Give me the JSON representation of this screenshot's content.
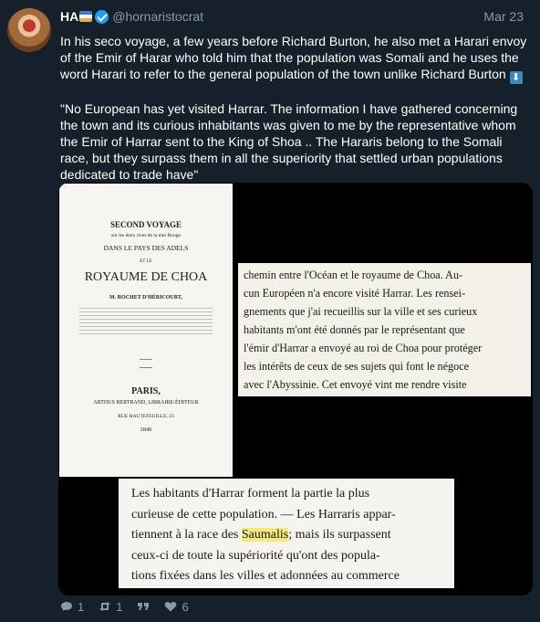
{
  "tweet": {
    "name": "HA",
    "handle": "@hornaristocrat",
    "date": "Mar 23",
    "paragraph1": "In his seco voyage, a few years before Richard Burton, he also met a Harari envoy of the Emir of Harar who told him that the population was Somali and he uses the word Harari to refer to the general population of the town unlike Richard Burton",
    "paragraph2": "\"No European has yet visited Harrar. The information I have gathered concerning the town and its curious inhabitants was given to me by the representative whom the Emir of Harrar sent to the King of Shoa .. The Hararis belong to the Somali race, but they surpass them in all the superiority that settled urban populations dedicated to trade have\""
  },
  "book_cover": {
    "title1": "SECOND VOYAGE",
    "title2": "sur les deux rives de la mer Rouge",
    "title3": "DANS LE PAYS DES ADELS",
    "title4": "ET LE",
    "title5": "ROYAUME DE CHOA",
    "author": "M. ROCHET D'HÉRICOURT,",
    "city": "PARIS,",
    "publisher": "ARTHUS BERTRAND, LIBRAIRE-ÉDITEUR",
    "address": "RUE HAUTEFEUILLE, 23",
    "year": "1846"
  },
  "scan1": {
    "lines": [
      "chemin entre l'Océan et le royaume de Choa. Au-",
      "cun Européen n'a encore visité Harrar. Les rensei-",
      "gnements que j'ai recueillis sur la ville et ses curieux",
      "habitants m'ont été donnés par le représentant que",
      "l'émir d'Harrar a envoyé au roi de Choa pour protéger",
      "les intérêts de ceux de ses sujets qui font le négoce",
      "avec l'Abyssinie. Cet envoyé vint me rendre visite"
    ]
  },
  "scan2": {
    "line1": "Les habitants d'Harrar forment la partie la plus",
    "line2": "curieuse de cette population. — Les Harraris appar-",
    "line3_pre": "tiennent à la race des ",
    "line3_hl": "Saumalis",
    "line3_post": "; mais ils surpassent",
    "line4": "ceux-ci de toute la supériorité qu'ont des popula-",
    "line5": "tions fixées dans les villes et adonnées au commerce"
  },
  "actions": {
    "replies": "1",
    "retweets": "1",
    "likes": "6"
  },
  "colors": {
    "background": "#15202b",
    "verified": "#1da1f2",
    "muted": "#8899a6"
  }
}
